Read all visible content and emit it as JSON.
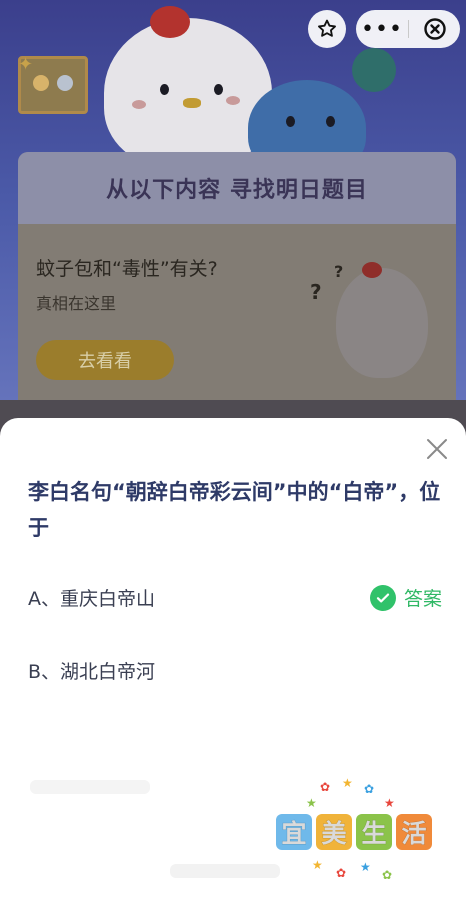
{
  "background": {
    "card": {
      "header_title": "从以下内容  寻找明日题目",
      "question": "蚊子包和“毒性”有关?",
      "subtitle": "真相在这里",
      "button_label": "去看看"
    }
  },
  "top_controls": {
    "more_glyph": "•••"
  },
  "sheet": {
    "question": "李白名句“朝辞白帝彩云间”中的“白帝”，位于",
    "options": [
      {
        "label": "A、重庆白帝山",
        "is_answer": true
      },
      {
        "label": "B、湖北白帝河",
        "is_answer": false
      }
    ],
    "answer_label": "答案"
  },
  "watermark": {
    "chars": [
      "宜",
      "美",
      "生",
      "活"
    ]
  },
  "colors": {
    "accent_green": "#30c26a",
    "question_navy": "#2e3a67",
    "sheet_bg": "#ffffff"
  },
  "icons": {
    "favorite": "star-outline-icon",
    "more": "more-dots-icon",
    "close_mini": "circle-close-icon",
    "sheet_close": "close-x-icon",
    "answer": "check-circle-icon"
  }
}
